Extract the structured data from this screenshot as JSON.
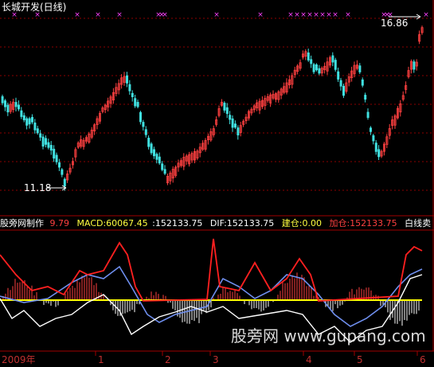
{
  "title": "长城开发(日线)",
  "price_labels": {
    "high": "16.86",
    "low": "11.18"
  },
  "indicator_bar": {
    "source": "股旁网制作",
    "first_value": "9.79",
    "macd": "MACD:60067.45",
    "sep_value": ":152133.75",
    "dif": "DIF:152133.75",
    "jiancang": "建仓:0.00",
    "jiacang": "加仓:152133.75",
    "baixianmai": "白线卖"
  },
  "watermark": "股旁网  www.gupang.com",
  "xaxis": {
    "year": "2009年",
    "ticks": [
      "1",
      "2",
      "3",
      "4",
      "5",
      "6"
    ]
  },
  "colors": {
    "background": "#000000",
    "up": "#ff4040",
    "down": "#40e0e0",
    "marker": "#ff40ff",
    "grid": "#8b0000",
    "axis": "#a00000",
    "zero_line": "#ffff00",
    "blue_line": "#6f8fef",
    "red_line": "#ff2020",
    "white_line": "#ffffff"
  }
}
